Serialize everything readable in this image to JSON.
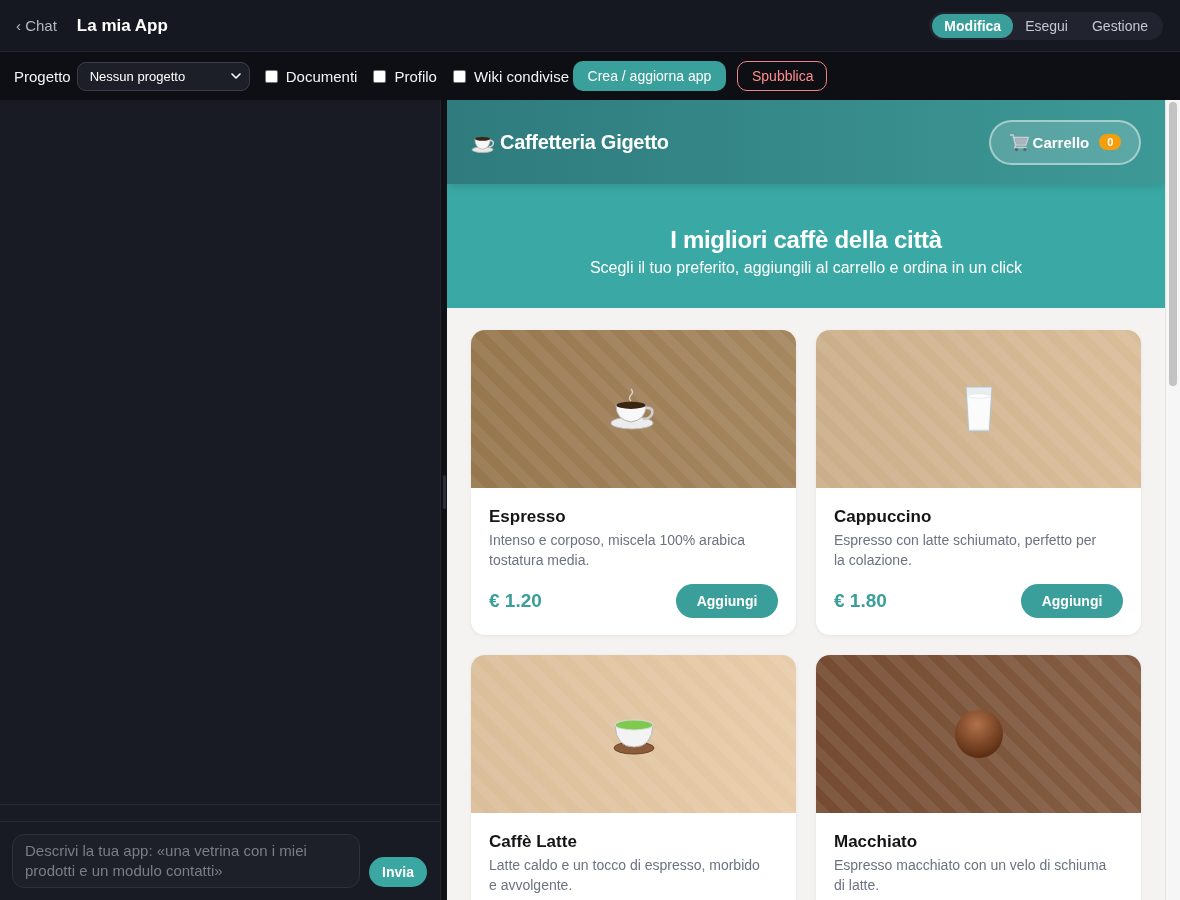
{
  "top_bar": {
    "back_link": "‹ Chat",
    "title": "La mia App",
    "tabs": [
      {
        "label": "Modifica",
        "selected": true
      },
      {
        "label": "Esegui",
        "selected": false
      },
      {
        "label": "Gestione",
        "selected": false
      }
    ]
  },
  "toolbar": {
    "project_label": "Progetto",
    "project_select": {
      "value": "Nessun progetto"
    },
    "checkboxes": [
      {
        "label": "Documenti",
        "checked": false
      },
      {
        "label": "Profilo",
        "checked": false
      },
      {
        "label": "Wiki condivise",
        "checked": false
      }
    ],
    "buttons": [
      {
        "label": "Crea / aggiorna app",
        "kind": "primary"
      },
      {
        "label": "Spubblica",
        "kind": "danger"
      }
    ]
  },
  "chat": {
    "input": {
      "placeholder": "Descrivi la tua app: «una vetrina con i miei prodotti e un modulo contatti»"
    },
    "send_button": "Invia"
  },
  "preview": {
    "header": {
      "brand": "Caffetteria Gigetto",
      "cart": {
        "label": "Carrello",
        "count": "0"
      }
    },
    "hero": {
      "title": "I migliori caffè della città",
      "subtitle": "Scegli il tuo preferito, aggiungili al carrello e ordina in un click"
    },
    "products": [
      {
        "kind": "cup",
        "color": "#9e7d52",
        "name": "Espresso",
        "description": "Intenso e corposo, miscela 100% arabica tostatura media.",
        "price": "€ 1.20",
        "button": "Aggiungi"
      },
      {
        "kind": "glass",
        "color": "#d6b891",
        "name": "Cappuccino",
        "description": "Espresso con latte schiumato, perfetto per la colazione.",
        "price": "€ 1.80",
        "button": "Aggiungi"
      },
      {
        "kind": "teacup",
        "color": "#e6c8a2",
        "name": "Caffè Latte",
        "description": "Latte caldo e un tocco di espresso, morbido e avvolgente."
      },
      {
        "kind": "sphere",
        "color": "#7b5034",
        "name": "Macchiato",
        "description": "Espresso macchiato con un velo di schiuma di latte."
      }
    ]
  }
}
